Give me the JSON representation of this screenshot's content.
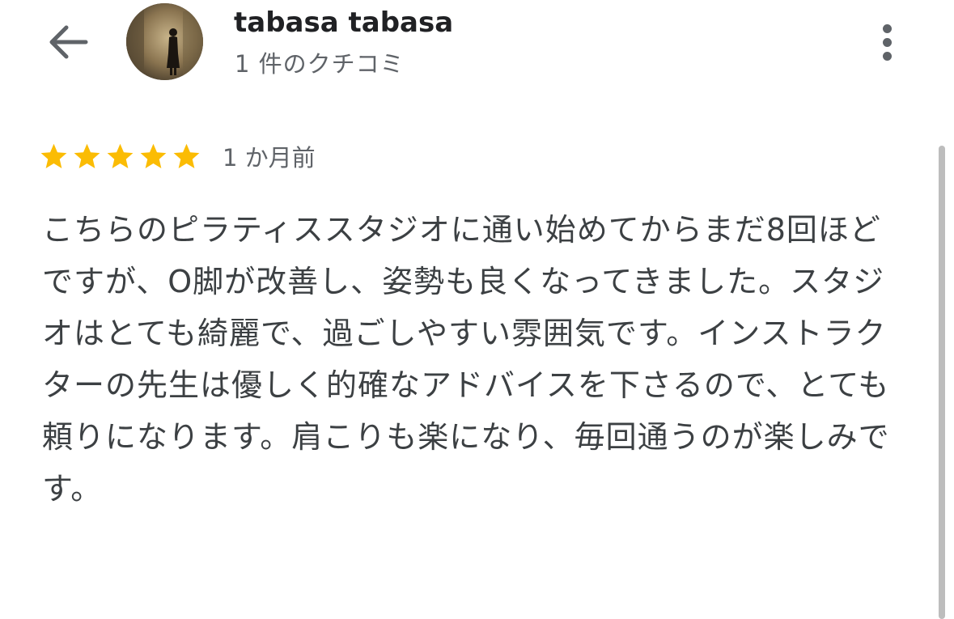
{
  "header": {
    "back_icon": "arrow-left-icon",
    "avatar_icon": "user-avatar-photo",
    "reviewer_name": "tabasa tabasa",
    "review_count": "1 件のクチコミ",
    "more_icon": "more-vertical-icon"
  },
  "review": {
    "rating": 5,
    "max_rating": 5,
    "star_icon": "star-icon",
    "star_color": "#FBBC04",
    "time": "1 か月前",
    "text": "こちらのピラティススタジオに通い始めてからまだ8回ほどですが、O脚が改善し、姿勢も良くなってきました。スタジオはとても綺麗で、過ごしやすい雰囲気です。インストラクターの先生は優しく的確なアドバイスを下さるので、とても頼りになります。肩こりも楽になり、毎回通うのが楽しみです。"
  },
  "colors": {
    "name_text": "#202124",
    "secondary_text": "#5f6368",
    "body_text": "#3c4043",
    "scrollbar": "#bdbdbd"
  }
}
